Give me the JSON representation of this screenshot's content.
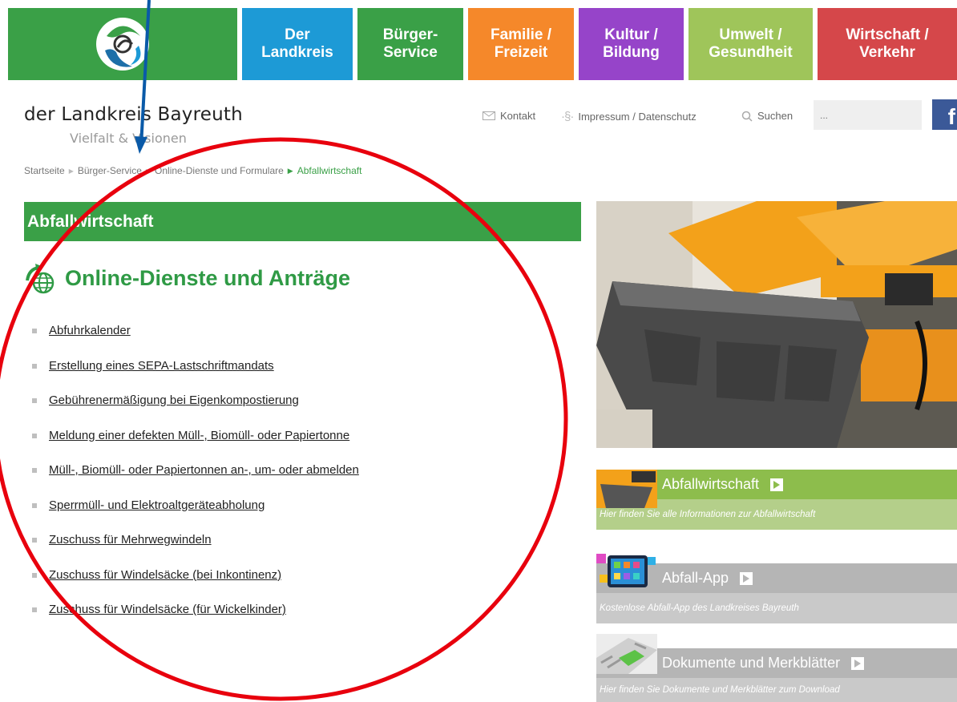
{
  "nav": {
    "items": [
      {
        "label": "Der\nLandkreis",
        "color": "#1d9ad6"
      },
      {
        "label": "Bürger-\nService",
        "color": "#3aa047"
      },
      {
        "label": "Familie /\nFreizeit",
        "color": "#f5882a"
      },
      {
        "label": "Kultur /\nBildung",
        "color": "#9644c9"
      },
      {
        "label": "Umwelt /\nGesundheit",
        "color": "#9fc55a"
      },
      {
        "label": "Wirtschaft /\nVerkehr",
        "color": "#d5474a"
      }
    ]
  },
  "brand": {
    "name": "der Landkreis Bayreuth",
    "tagline": "Vielfalt & Visionen"
  },
  "utility": {
    "contact": "Kontakt",
    "imprint": "Impressum / Datenschutz",
    "search_label": "Suchen",
    "search_placeholder": "...",
    "facebook": "f"
  },
  "breadcrumb": [
    "Startseite",
    "Bürger-Service",
    "Online-Dienste und Formulare",
    "Abfallwirtschaft"
  ],
  "page": {
    "title": "Abfallwirtschaft",
    "subtitle": "Online-Dienste und Anträge"
  },
  "links": [
    "Abfuhrkalender",
    "Erstellung eines SEPA-Lastschriftmandats",
    "Gebührenermäßigung bei Eigenkompostierung",
    "Meldung einer defekten Müll-, Biomüll- oder Papiertonne",
    "Müll-, Biomüll- oder Papiertonnen an-, um- oder abmelden",
    "Sperrmüll- und Elektroaltgeräteabholung",
    "Zuschuss für Mehrwegwindeln",
    "Zuschuss für Windelsäcke (bei Inkontinenz)",
    "Zuschuss für Windelsäcke (für Wickelkinder)"
  ],
  "teasers": [
    {
      "title": "Abfallwirtschaft",
      "desc": "Hier finden Sie alle Informationen zur Abfallwirtschaft",
      "bar_color": "#8dbd4c",
      "desc_color": "#b4cf8a"
    },
    {
      "title": "Abfall-App",
      "desc": "Kostenlose Abfall-App des Landkreises Bayreuth",
      "bar_color": "#b5b5b5",
      "desc_color": "#c9c9c9"
    },
    {
      "title": "Dokumente und Merkblätter",
      "desc": "Hier finden Sie Dokumente und Merkblätter zum Download",
      "bar_color": "#b5b5b5",
      "desc_color": "#c9c9c9"
    }
  ],
  "annotations": {
    "ellipse_color": "#e8000d",
    "arrow_color": "#0a5aa8"
  }
}
